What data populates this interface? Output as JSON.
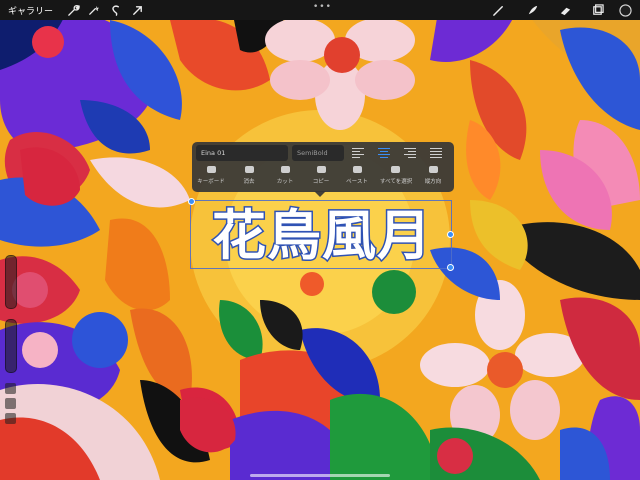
{
  "topbar": {
    "gallery_label": "ギャラリー",
    "tools_left": [
      "wrench-icon",
      "magic-wand-icon",
      "selection-icon",
      "transform-arrow-icon"
    ],
    "tools_right": [
      "brush-icon",
      "smudge-icon",
      "eraser-icon",
      "layers-icon"
    ],
    "color_swatch": "#1f1f1f"
  },
  "text_popup": {
    "font_name": "Eina 01",
    "font_style": "SemiBold",
    "alignments": [
      "left",
      "center",
      "right",
      "justify"
    ],
    "active_alignment": "center",
    "actions": [
      {
        "label": "キーボード",
        "icon": "keyboard-icon"
      },
      {
        "label": "消去",
        "icon": "broom-icon"
      },
      {
        "label": "カット",
        "icon": "scissors-icon"
      },
      {
        "label": "コピー",
        "icon": "copy-icon"
      },
      {
        "label": "ペースト",
        "icon": "paste-icon"
      },
      {
        "label": "すべてを選択",
        "icon": "select-all-icon"
      },
      {
        "label": "縦方向",
        "icon": "vertical-text-icon"
      }
    ]
  },
  "canvas_text": "花鳥風月",
  "colors": {
    "accent": "#3a8ef6",
    "text_outline": "#2f52b4",
    "popup_bg": "#373737"
  }
}
